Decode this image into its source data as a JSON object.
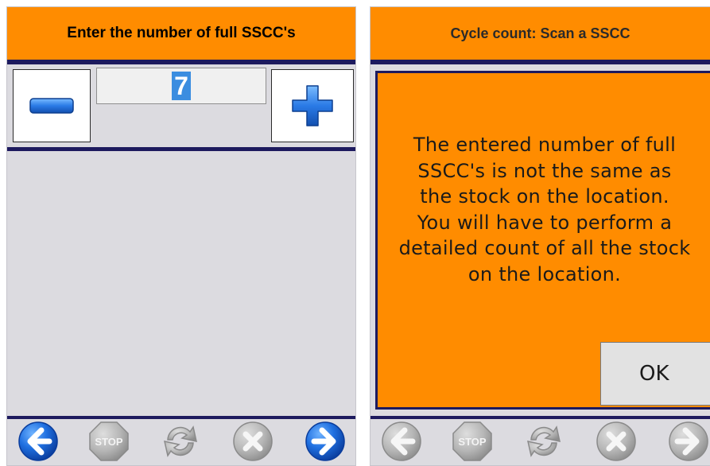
{
  "left": {
    "header": "Enter the number of full SSCC's",
    "count_value": "7"
  },
  "right": {
    "header": "Cycle count: Scan a SSCC",
    "dialog_message": "The entered number of full\nSSCC's is not the same as\nthe stock on the location.\n You will have to perform a\ndetailed count of all the stock\non the location.",
    "ok_label": "OK"
  },
  "footer_icons": {
    "back": "back-arrow-icon",
    "stop": "stop-icon",
    "stop_label": "STOP",
    "refresh": "refresh-icon",
    "cancel": "cancel-icon",
    "next": "forward-arrow-icon"
  },
  "colors": {
    "accent": "#ff8c00",
    "navy": "#1d1a5e",
    "panel": "#dcdbe0",
    "button_blue": "#1560d6"
  }
}
